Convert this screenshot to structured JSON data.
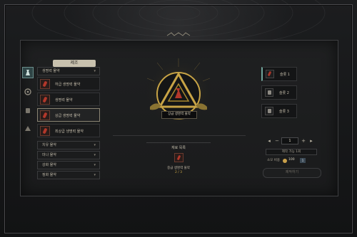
{
  "ui": {
    "list_header": "제조",
    "accent_teal": "#6fa39a",
    "gold": "#c8a446"
  },
  "side_icons": [
    {
      "name": "potion-tab-icon",
      "active": true
    },
    {
      "name": "gear-tab-icon",
      "active": false
    },
    {
      "name": "cooking-tab-icon",
      "active": false
    },
    {
      "name": "material-tab-icon",
      "active": false
    }
  ],
  "categories": {
    "top": {
      "label": "생명력 물약"
    },
    "items": [
      {
        "label": "하급 생명력 물약"
      },
      {
        "label": "생명력 물약"
      },
      {
        "label": "상급 생명력 물약"
      },
      {
        "label": "최상급 생명력 물약"
      }
    ],
    "bottom": [
      {
        "label": "치유 물약"
      },
      {
        "label": "마나 물약"
      },
      {
        "label": "강화 물약"
      },
      {
        "label": "정화 물약"
      }
    ]
  },
  "emblem": {
    "label": "상급 생명력 물약"
  },
  "materials": {
    "title": "재료 목록",
    "item_name": "중급 생명력 물약",
    "item_qty": "2 / 3"
  },
  "results": [
    {
      "label": "슬롯 1"
    },
    {
      "label": "슬롯 2"
    },
    {
      "label": "슬롯 3"
    }
  ],
  "quantity": {
    "minus": "−",
    "plus": "+",
    "value": "1",
    "prev": "◂",
    "next": "▸"
  },
  "requirement": "제작 가능 1회",
  "cost": {
    "label": "소모 비용",
    "value": "100",
    "badge": "1"
  },
  "craft_button": "제작하기"
}
